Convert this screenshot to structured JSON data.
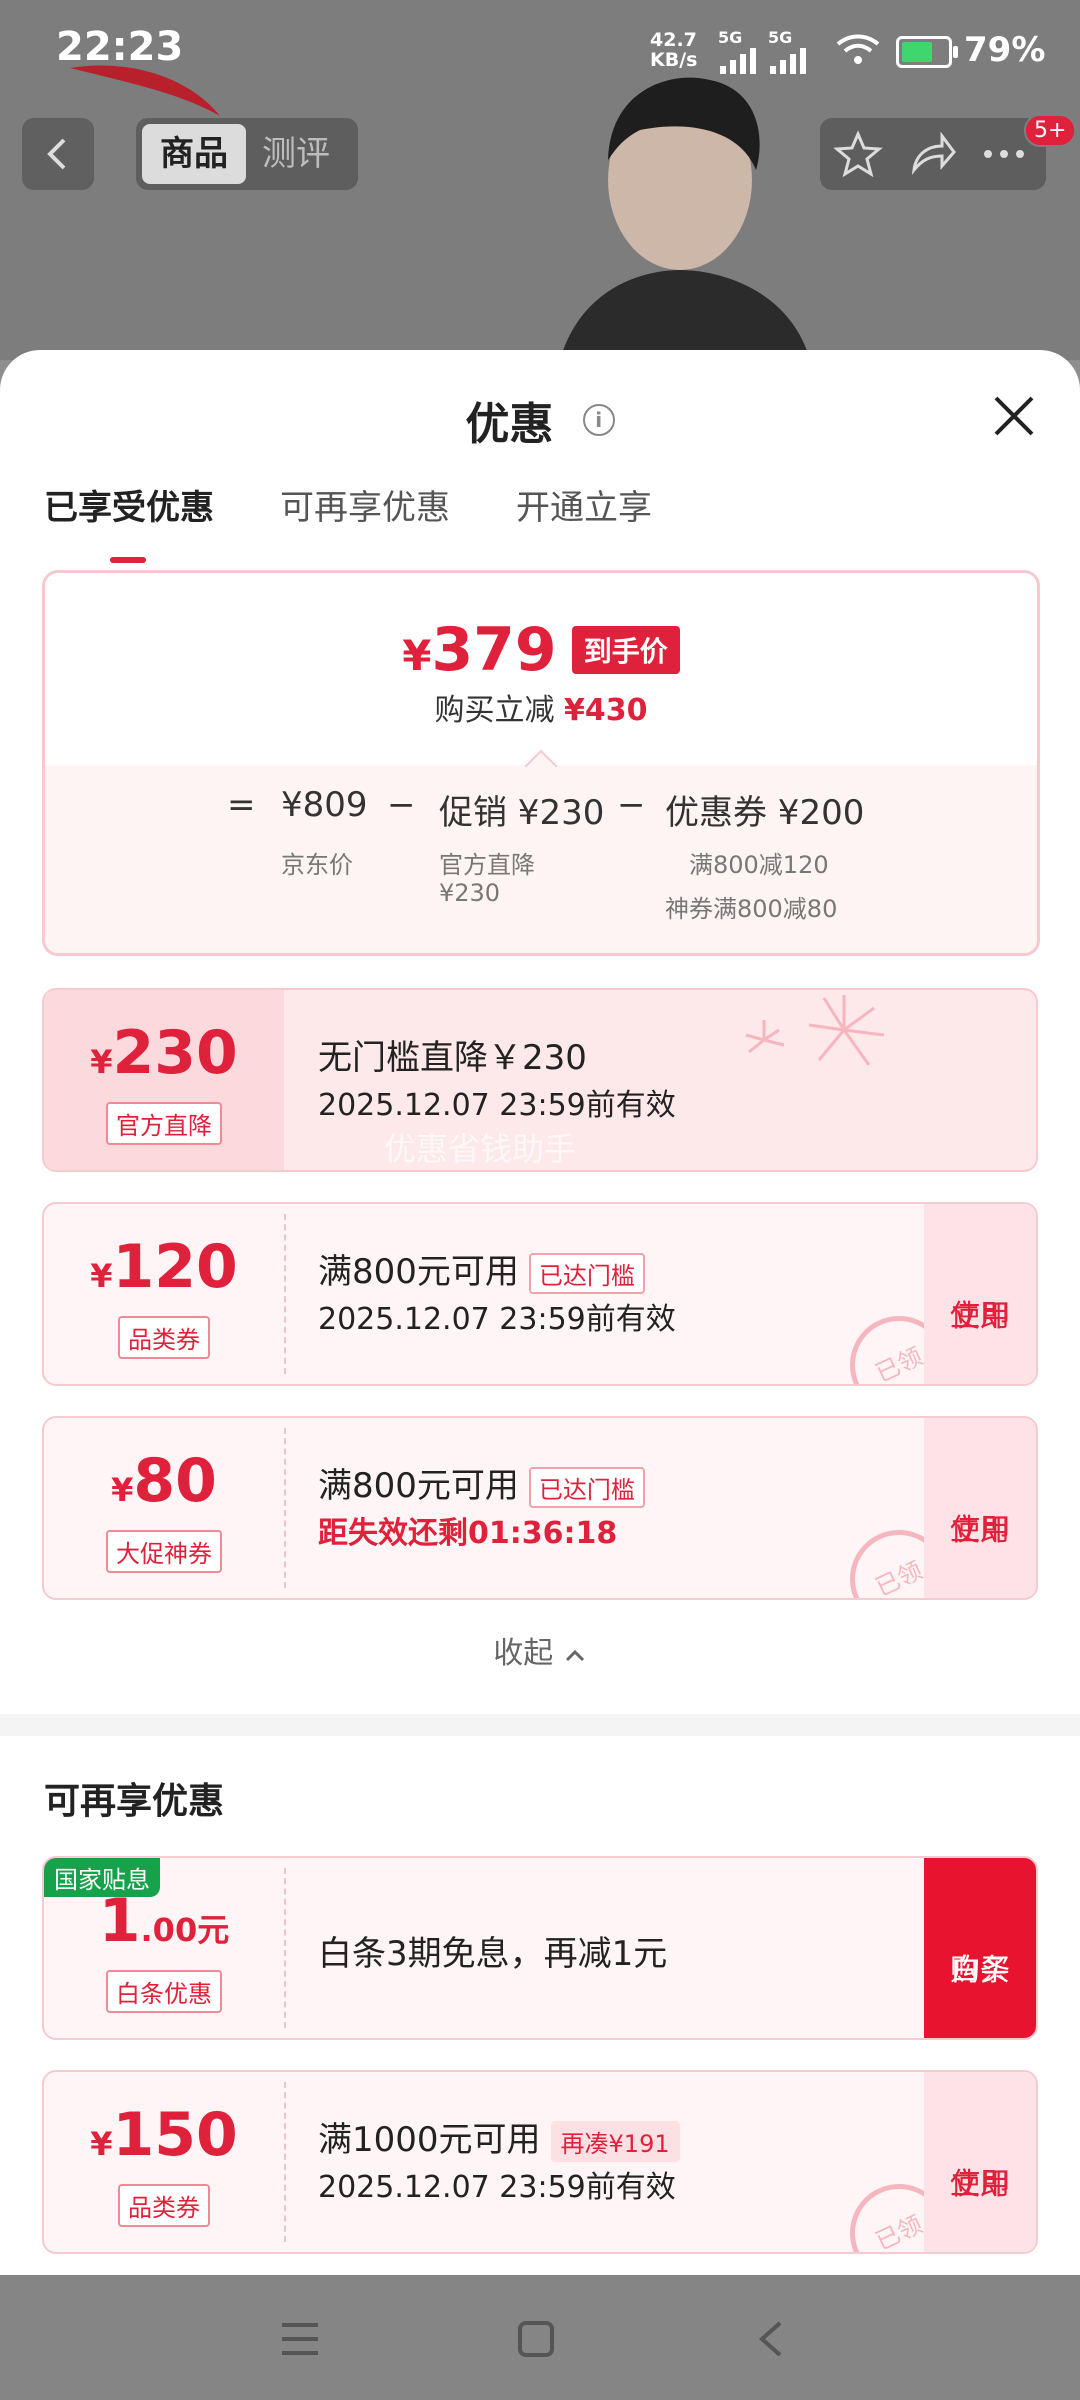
{
  "status": {
    "time": "22:23",
    "net_speed": "42.7",
    "net_unit": "KB/s",
    "sig1": "5G",
    "sig2": "5G",
    "battery": "79%"
  },
  "topnav": {
    "tab_product": "商品",
    "tab_review": "测评",
    "badge": "5+"
  },
  "sheet": {
    "title": "优惠",
    "tabs": [
      "已享受优惠",
      "可再享优惠",
      "开通立享"
    ],
    "summary": {
      "price_symbol": "¥",
      "price": "379",
      "price_tag": "到手价",
      "save_label": "购买立减",
      "save_amount": "¥430",
      "eq": "=",
      "jd_price": "¥809",
      "jd_label": "京东价",
      "minus1": "−",
      "promo": "促销 ¥230",
      "promo_label1": "官方直降",
      "promo_label2": "¥230",
      "minus2": "−",
      "coupon": "优惠券 ¥200",
      "coupon_label1": "满800减120",
      "coupon_label2": "神券满800减80"
    },
    "coupons": [
      {
        "symbol": "¥",
        "amount": "230",
        "tag": "官方直降",
        "title": "无门槛直降￥230",
        "sub": "2025.12.07 23:59前有效"
      },
      {
        "symbol": "¥",
        "amount": "120",
        "tag": "品类券",
        "title": "满800元可用",
        "pill": "已达门槛",
        "sub": "2025.12.07 23:59前有效",
        "btn1": "立即",
        "btn2": "使用",
        "stamp": "已领"
      },
      {
        "symbol": "¥",
        "amount": "80",
        "tag": "大促神券",
        "title": "满800元可用",
        "pill": "已达门槛",
        "sub": "距失效还剩01:36:18",
        "btn1": "立即",
        "btn2": "使用",
        "stamp": "已领"
      }
    ],
    "watermark": "优惠省钱助手",
    "collapse": "收起",
    "section2_title": "可再享优惠",
    "more": [
      {
        "gov": "国家贴息",
        "amount": "1",
        "dec": ".00元",
        "tag": "白条优惠",
        "title": "白条3期免息，再减1元",
        "btn1": "白条",
        "btn2": "购买"
      },
      {
        "symbol": "¥",
        "amount": "150",
        "tag": "品类券",
        "title": "满1000元可用",
        "pill": "再凑¥191",
        "sub": "2025.12.07 23:59前有效",
        "btn1": "立即",
        "btn2": "使用",
        "stamp": "已领"
      }
    ]
  },
  "colors": {
    "accent": "#e0213b",
    "gov_green": "#16a24a"
  }
}
